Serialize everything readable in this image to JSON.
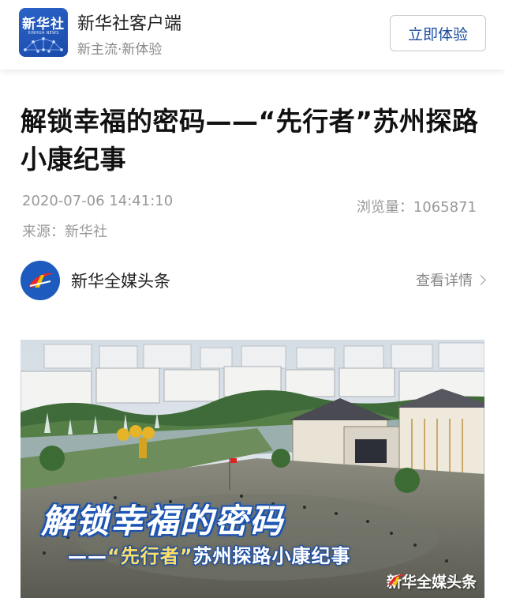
{
  "app_banner": {
    "logo_text": "新华社",
    "logo_sub": "XINHUA NEWS",
    "name": "新华社客户端",
    "slogan": "新主流·新体验",
    "try_button": "立即体验"
  },
  "article": {
    "title": "解锁幸福的密码——“先行者”苏州探路小康纪事",
    "datetime": "2020-07-06 14:41:10",
    "views_label": "浏览量：1065871",
    "source_label": "来源：新华社"
  },
  "publisher": {
    "name": "新华全媒头条",
    "detail_link": "查看详情"
  },
  "cover": {
    "title": "解锁幸福的密码",
    "subtitle_prefix": "——",
    "subtitle_quote": "“先行者”",
    "subtitle_rest": "苏州探路小康纪事",
    "brand": "新华全媒头条"
  },
  "colors": {
    "accent_blue": "#1c4ea0",
    "logo_blue": "#2a63c8",
    "meta_gray": "#999999"
  }
}
